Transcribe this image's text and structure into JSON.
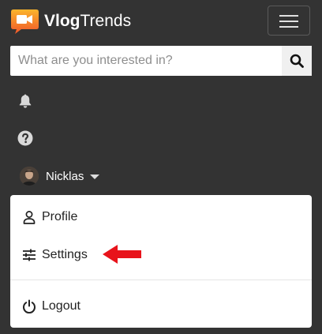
{
  "brand": {
    "name_bold": "Vlog",
    "name_regular": "Trends",
    "accent_color": "#f7a823"
  },
  "header": {
    "menu_toggle_icon": "hamburger-icon"
  },
  "search": {
    "placeholder": "What are you interested in?",
    "value": "",
    "button_icon": "search-icon"
  },
  "nav": {
    "notifications_icon": "bell-icon",
    "help_icon": "question-circle-icon",
    "user": {
      "name": "Nicklas",
      "caret_icon": "caret-down-icon"
    }
  },
  "dropdown": {
    "items": [
      {
        "label": "Profile",
        "icon": "user-icon"
      },
      {
        "label": "Settings",
        "icon": "sliders-icon"
      },
      {
        "label": "Logout",
        "icon": "power-icon"
      }
    ]
  },
  "annotation": {
    "arrow_color": "#e8131b"
  }
}
